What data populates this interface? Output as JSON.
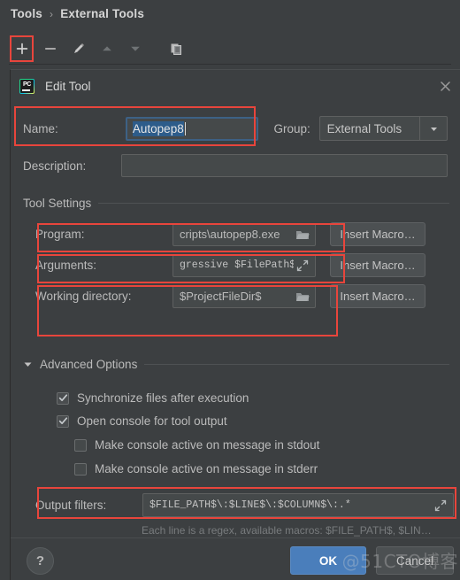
{
  "breadcrumb": {
    "root": "Tools",
    "separator": "›",
    "current": "External Tools"
  },
  "toolbar": {
    "items": [
      {
        "name": "add-button",
        "icon": "plus-icon",
        "tooltip": "Add"
      },
      {
        "name": "remove-button",
        "icon": "minus-icon",
        "tooltip": "Remove"
      },
      {
        "name": "edit-button",
        "icon": "pencil-icon",
        "tooltip": "Edit"
      },
      {
        "name": "move-up-button",
        "icon": "arrow-up-icon",
        "tooltip": "Move Up"
      },
      {
        "name": "move-down-button",
        "icon": "arrow-down-icon",
        "tooltip": "Move Down"
      },
      {
        "name": "copy-button",
        "icon": "copy-icon",
        "tooltip": "Copy"
      }
    ]
  },
  "dialog": {
    "title": "Edit Tool",
    "app_icon": "pycharm-logo-icon",
    "close_icon": "close-icon",
    "name": {
      "label": "Name:",
      "value": "Autopep8",
      "selected": true
    },
    "group": {
      "label": "Group:",
      "value": "External Tools",
      "arrow_icon": "chevron-down-icon"
    },
    "description": {
      "label": "Description:",
      "value": "",
      "placeholder": ""
    },
    "tool_settings": {
      "section_label": "Tool Settings",
      "rows": [
        {
          "label": "Program:",
          "value": "cripts\\autopep8.exe",
          "field_icon": "folder-icon",
          "monospace": false,
          "button": "Insert Macro…"
        },
        {
          "label": "Arguments:",
          "value": "gressive $FilePath$",
          "field_icon": "expand-icon",
          "monospace": true,
          "button": "Insert Macro…"
        },
        {
          "label": "Working directory:",
          "value": "$ProjectFileDir$",
          "field_icon": "folder-icon",
          "monospace": false,
          "button": "Insert Macro…"
        }
      ]
    },
    "advanced_options": {
      "section_label": "Advanced Options",
      "expanded": true,
      "toggle_icon": "triangle-down-icon",
      "checkboxes": [
        {
          "label": "Synchronize files after execution",
          "checked": true,
          "indent": 0
        },
        {
          "label": "Open console for tool output",
          "checked": true,
          "indent": 0
        },
        {
          "label": "Make console active on message in stdout",
          "checked": false,
          "indent": 1
        },
        {
          "label": "Make console active on message in stderr",
          "checked": false,
          "indent": 1
        }
      ],
      "output_filters": {
        "label": "Output filters:",
        "value": "$FILE_PATH$\\:$LINE$\\:$COLUMN$\\:.*",
        "field_icon": "expand-icon",
        "hint": "Each line is a regex, available macros: $FILE_PATH$, $LIN…"
      }
    },
    "footer": {
      "help_label": "?",
      "ok_label": "OK",
      "cancel_label": "Cancel"
    }
  },
  "watermark": {
    "text": "@51CTO博客"
  },
  "colors": {
    "window_background": "#3c3f41",
    "field_background": "#45494a",
    "accent_button": "#4a7ebb",
    "selection": "#2d5c8a",
    "focus_border": "#3d6185",
    "annotation": "#e8453c",
    "text": "#bbbbbb"
  }
}
